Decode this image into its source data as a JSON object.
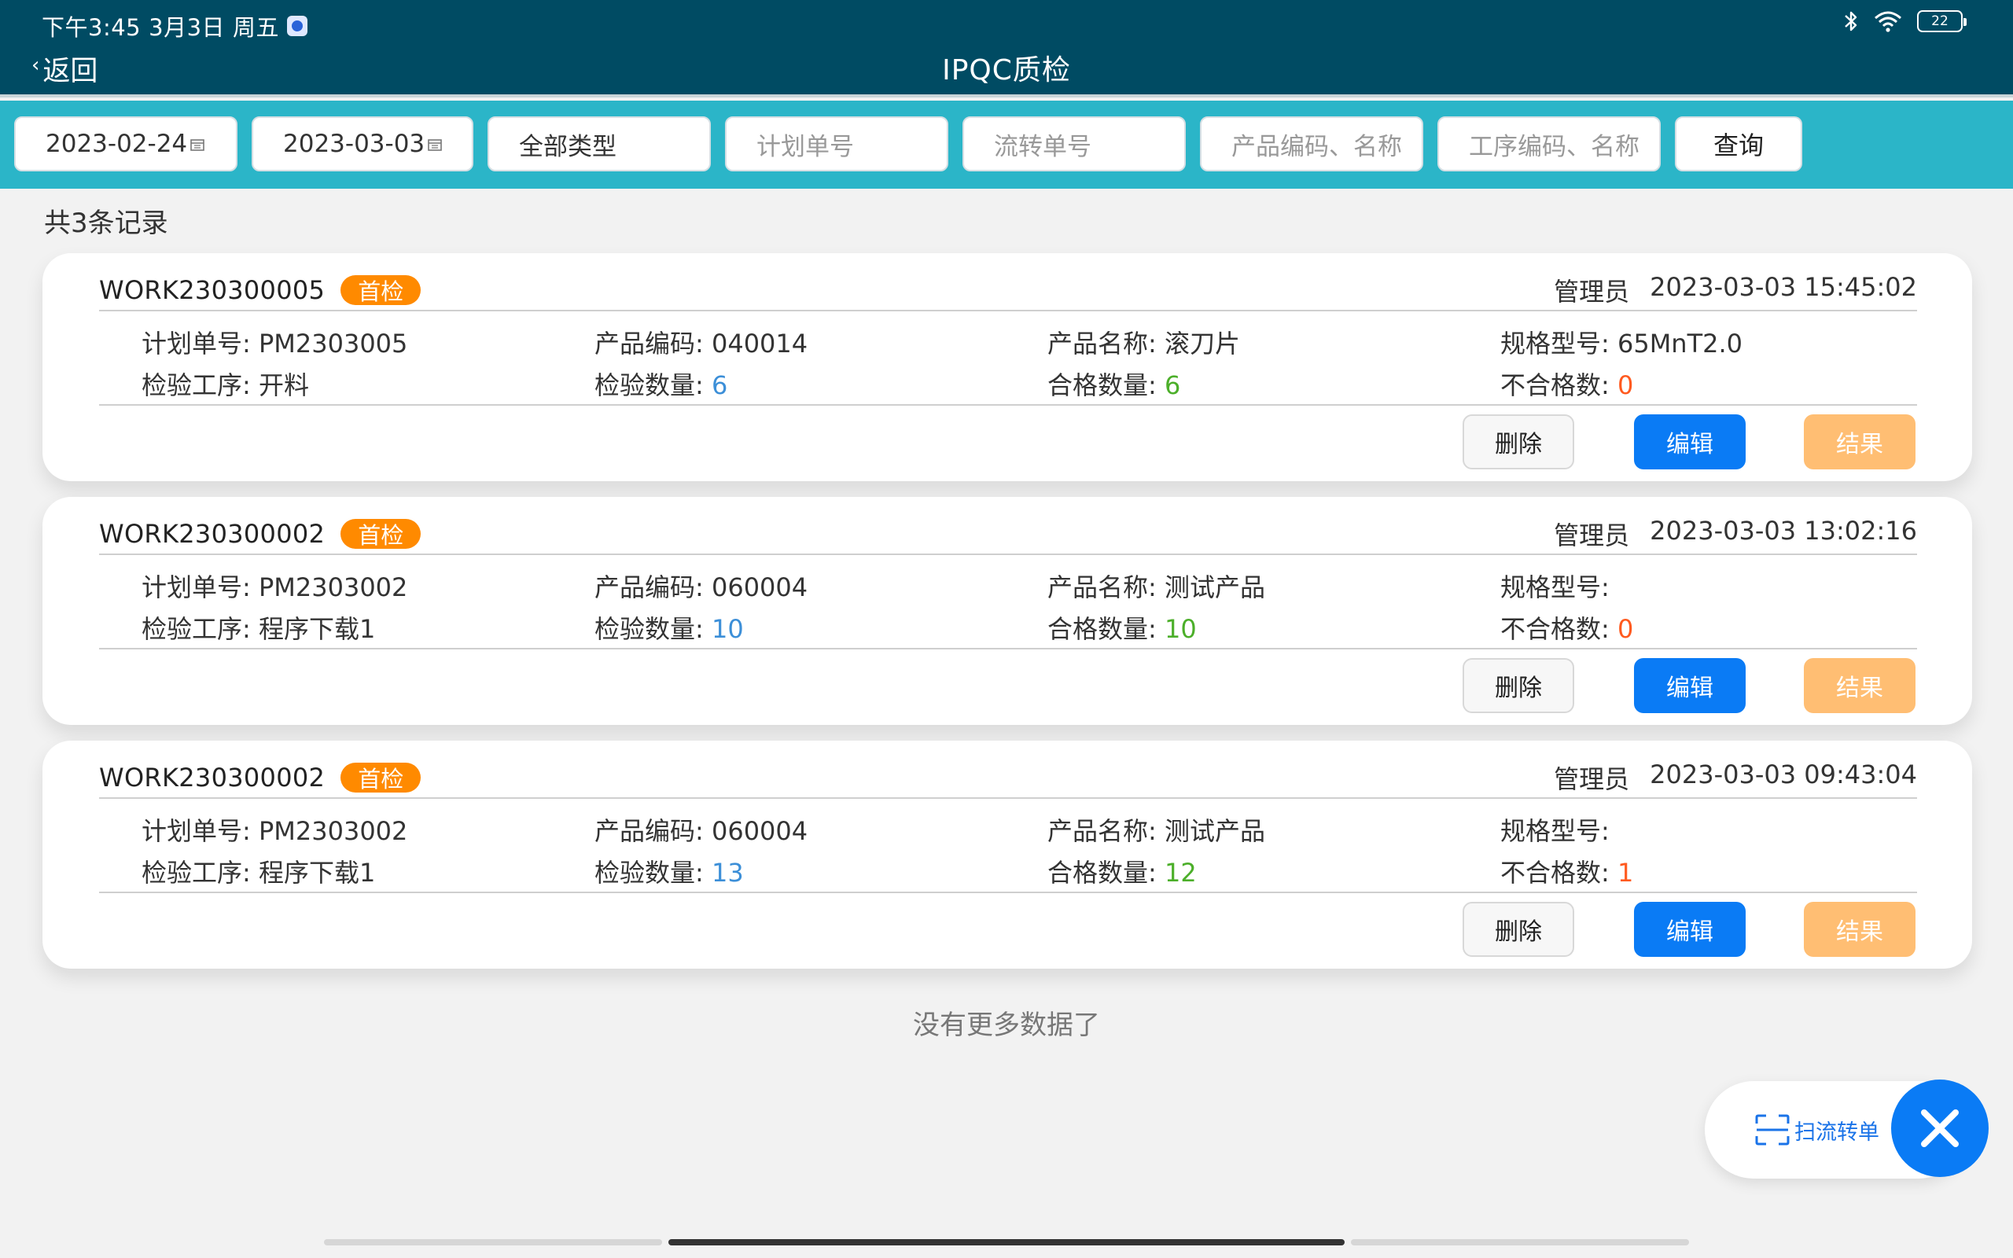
{
  "status_bar": {
    "time": "下午3:45",
    "date": "3月3日",
    "weekday": "周五",
    "battery": "22"
  },
  "nav": {
    "back_label": "返回",
    "title": "IPQC质检"
  },
  "filters": {
    "start_date": "2023-02-24",
    "end_date": "2023-03-03",
    "type": "全部类型",
    "plan_no_placeholder": "计划单号",
    "flow_no_placeholder": "流转单号",
    "product_placeholder": "产品编码、名称",
    "process_placeholder": "工序编码、名称",
    "query_label": "查询"
  },
  "labels": {
    "plan_no": "计划单号:",
    "product_code": "产品编码:",
    "product_name": "产品名称:",
    "spec": "规格型号:",
    "process": "检验工序:",
    "inspect_qty": "检验数量:",
    "pass_qty": "合格数量:",
    "fail_qty": "不合格数:",
    "delete": "删除",
    "edit": "编辑",
    "result": "结果"
  },
  "record_count": "共3条记录",
  "records": [
    {
      "work_no": "WORK230300005",
      "tag": "首检",
      "user": "管理员",
      "time": "2023-03-03 15:45:02",
      "plan_no": "PM2303005",
      "product_code": "040014",
      "product_name": "滚刀片",
      "spec": "65MnT2.0",
      "process": "开料",
      "inspect_qty": "6",
      "pass_qty": "6",
      "fail_qty": "0"
    },
    {
      "work_no": "WORK230300002",
      "tag": "首检",
      "user": "管理员",
      "time": "2023-03-03 13:02:16",
      "plan_no": "PM2303002",
      "product_code": "060004",
      "product_name": "测试产品",
      "spec": "",
      "process": "程序下载1",
      "inspect_qty": "10",
      "pass_qty": "10",
      "fail_qty": "0"
    },
    {
      "work_no": "WORK230300002",
      "tag": "首检",
      "user": "管理员",
      "time": "2023-03-03 09:43:04",
      "plan_no": "PM2303002",
      "product_code": "060004",
      "product_name": "测试产品",
      "spec": "",
      "process": "程序下载1",
      "inspect_qty": "13",
      "pass_qty": "12",
      "fail_qty": "1"
    }
  ],
  "no_more": "没有更多数据了",
  "scan_label": "扫流转单",
  "colors": {
    "header": "#004b63",
    "filter_bar": "#2bb5c8",
    "tag": "#ff8a00",
    "edit": "#0a7bf5",
    "result": "#ffbe73"
  }
}
